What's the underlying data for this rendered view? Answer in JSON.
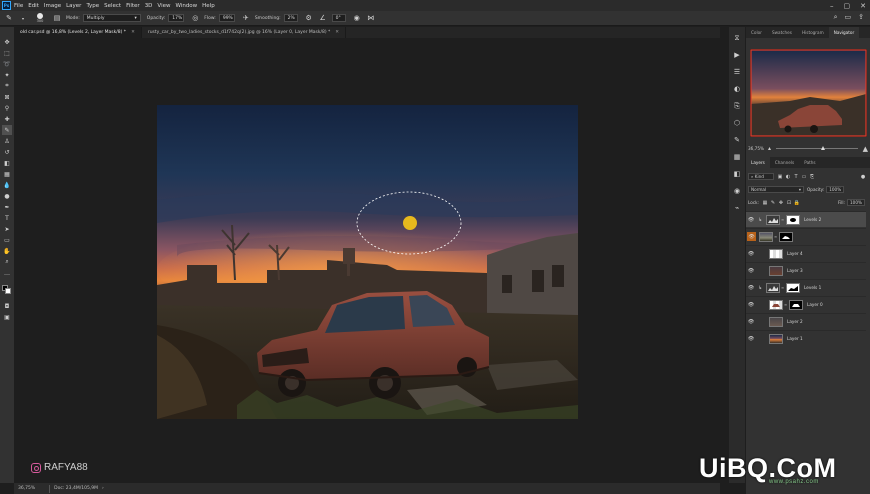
{
  "menu": {
    "app_icon": "Ps",
    "items": [
      "File",
      "Edit",
      "Image",
      "Layer",
      "Type",
      "Select",
      "Filter",
      "3D",
      "View",
      "Window",
      "Help"
    ],
    "window_controls": [
      "minimize-icon",
      "maximize-icon",
      "close-icon"
    ]
  },
  "options": {
    "brush_size": "300",
    "mode_label": "Mode:",
    "mode_value": "Multiply",
    "opacity_label": "Opacity:",
    "opacity_value": "17%",
    "flow_label": "Flow:",
    "flow_value": "99%",
    "smoothing_label": "Smoothing:",
    "smoothing_value": "2%",
    "angle_value": "0°"
  },
  "tabs": [
    {
      "label": "old car.psd @ 16,8% (Levels 2, Layer Mask/8) *",
      "active": true
    },
    {
      "label": "rusty_car_by_two_ladies_stocks_d1f742q(2).jpg @ 16% (Layer 0, Layer Mask/8) *",
      "active": false
    }
  ],
  "status": {
    "zoom": "36,75%",
    "doc": "Doc: 23,4M/105,9M"
  },
  "watermark_user": "RAFYA88",
  "brand": {
    "main": "UiBQ.CoM",
    "sub": "www.psahz.com"
  },
  "top_panel": {
    "tabs": [
      "Color",
      "Swatches",
      "Histogram",
      "Navigator"
    ],
    "active": "Navigator",
    "zoom": "36,75%"
  },
  "layers_panel": {
    "tabs": [
      "Layers",
      "Channels",
      "Paths"
    ],
    "active": "Layers",
    "filter_value": "Kind",
    "blend_mode": "Normal",
    "opacity_label": "Opacity:",
    "opacity_value": "100%",
    "lock_label": "Lock:",
    "fill_label": "Fill:",
    "fill_value": "100%",
    "layers": [
      {
        "name": "Levels 2",
        "type": "adjustment",
        "selected": true
      },
      {
        "name": "",
        "type": "masked",
        "selected": false
      },
      {
        "name": "Layer 4",
        "type": "pixel",
        "selected": false
      },
      {
        "name": "Layer 3",
        "type": "pixel",
        "selected": false
      },
      {
        "name": "Levels 1",
        "type": "adjustment",
        "selected": false
      },
      {
        "name": "Layer 0",
        "type": "masked",
        "selected": false
      },
      {
        "name": "Layer 2",
        "type": "pixel",
        "selected": false
      },
      {
        "name": "Layer 1",
        "type": "pixel",
        "selected": false
      }
    ]
  },
  "colors": {
    "accent": "#31a8ff",
    "selection_dot": "#e7b91d",
    "nav_frame": "#e03a2a"
  }
}
